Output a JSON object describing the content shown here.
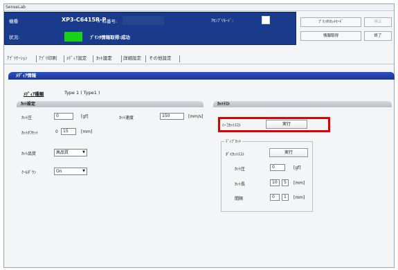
{
  "window": {
    "title": "SenseLab"
  },
  "header": {
    "model_label": "機種",
    "model_value": "XP3-C6415R-P",
    "serial_label": "ﾊﾟﾈﾙ番号:",
    "select_label": "ｱｾﾝﾌﾞﾘﾓｰﾄﾞ:",
    "status_label": "状況:",
    "status_text": "ﾌﾟﾘﾝﾀ情報取得:成功",
    "status_color": "#16d316"
  },
  "right_buttons": {
    "mode": "ﾌﾟﾘﾝﾀﾘｾｯﾄﾓｰﾄﾞ",
    "stop": "停止",
    "load": "情報取得",
    "exit": "終了"
  },
  "tabs": [
    "ｱﾌﾟﾘｹｰｼｮﾝ",
    "ｱﾌﾟﾘ印刷",
    "ﾒﾃﾞｨｱ設定",
    "ｶｯﾄ設定",
    "詳細設定",
    "その他設定"
  ],
  "media": {
    "section_title": "ﾒﾃﾞｨｱ情報",
    "type_label": "ﾒﾃﾞｨｱ種類",
    "type_value": "Type 1 ( Type1 )"
  },
  "cut_settings": {
    "title": "ｶｯﾄ設定",
    "pressure_label": "ｶｯﾄ圧",
    "pressure_value": "0",
    "pressure_unit": "[gf]",
    "speed_label": "ｶｯﾄ速度",
    "speed_value": "150",
    "speed_unit": "[mm/s]",
    "offset_label": "ｶｯﾄｵﾌｾｯﾄ",
    "offset_x": "0",
    "offset_value": "15",
    "offset_unit": "[mm]",
    "quality_label": "ｶｯﾄ品質",
    "quality_value": "高品質",
    "cooldown_label": "ｸｰﾙﾀﾞｳﾝ",
    "cooldown_value": "On"
  },
  "cut_test": {
    "title": "ｶｯﾄﾃｽﾄ",
    "half_label": "ﾊｰﾌｶｯﾄﾃｽﾄ",
    "run_label": "実行",
    "group_title": "ﾃﾞｨﾌﾟｶｯﾄ",
    "die_label": "ﾀﾞｲｶｯﾄﾃｽﾄ",
    "die_run": "実行",
    "pressure_label": "ｶｯﾄ圧",
    "pressure_value": "0",
    "pressure_unit": "[gf]",
    "length_label": "ｶｯﾄ長",
    "length_value": "10",
    "length_count": "5",
    "length_unit": "[mm]",
    "spacing_label": "間隔",
    "spacing_value": "0",
    "spacing_count": "1",
    "spacing_unit": "[mm]"
  }
}
